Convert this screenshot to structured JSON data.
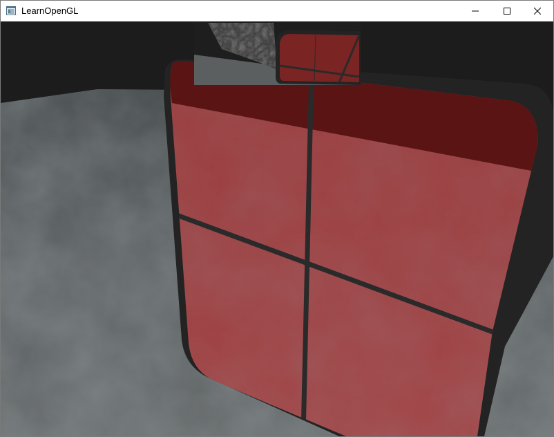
{
  "window": {
    "title": "LearnOpenGL",
    "buttons": {
      "minimize_icon": "minimize-icon",
      "maximize_icon": "maximize-icon",
      "close_icon": "close-icon"
    }
  },
  "scene": {
    "description_icon": "opengl-render",
    "colors": {
      "background": "#1a1a1a",
      "floor": "#5a5f60",
      "window_tint": "#8e2f30",
      "window_frame": "#222222",
      "rear_view": "#7a2020"
    }
  }
}
